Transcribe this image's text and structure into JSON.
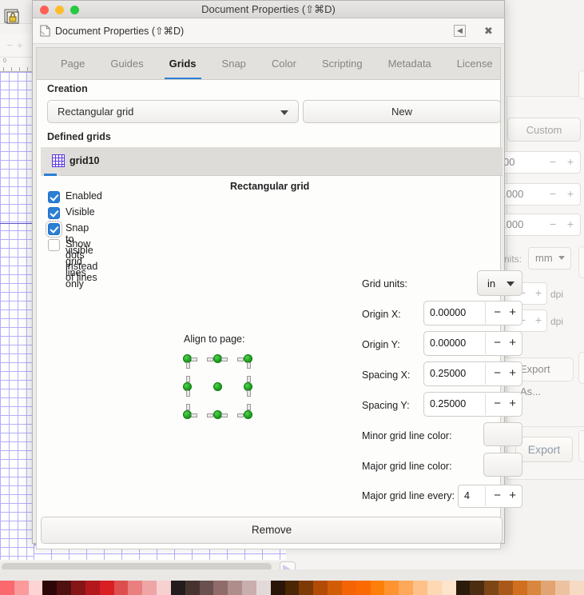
{
  "window": {
    "title": "Document Properties (⇧⌘D)",
    "subheader_title": "Document Properties (⇧⌘D)",
    "collapse_glyph": "◀",
    "close_glyph": "✖",
    "doc_icon": "document-icon"
  },
  "tabs": [
    {
      "label": "Page",
      "active": false
    },
    {
      "label": "Guides",
      "active": false
    },
    {
      "label": "Grids",
      "active": true
    },
    {
      "label": "Snap",
      "active": false
    },
    {
      "label": "Color",
      "active": false
    },
    {
      "label": "Scripting",
      "active": false
    },
    {
      "label": "Metadata",
      "active": false
    },
    {
      "label": "License",
      "active": false
    }
  ],
  "creation": {
    "section_label": "Creation",
    "grid_type": "Rectangular grid",
    "new_button": "New"
  },
  "defined_grids": {
    "section_label": "Defined grids",
    "items": [
      {
        "label": "grid10",
        "selected": true
      }
    ]
  },
  "grid_settings": {
    "title": "Rectangular grid",
    "checkboxes": [
      {
        "label": "Enabled",
        "checked": true,
        "focused": false
      },
      {
        "label": "Visible",
        "checked": true,
        "focused": false
      },
      {
        "label": "Snap to visible grid lines only",
        "checked": true,
        "focused": true
      },
      {
        "label": "Show dots instead of lines",
        "checked": false,
        "focused": false
      }
    ],
    "align_to_page_label": "Align to page:",
    "fields": [
      {
        "label": "Grid units:",
        "value": "in",
        "kind": "select"
      },
      {
        "label": "Origin X:",
        "value": "0.00000",
        "kind": "spin"
      },
      {
        "label": "Origin Y:",
        "value": "0.00000",
        "kind": "spin"
      },
      {
        "label": "Spacing X:",
        "value": "0.25000",
        "kind": "spin"
      },
      {
        "label": "Spacing Y:",
        "value": "0.25000",
        "kind": "spin"
      }
    ],
    "minor_color_label": "Minor grid line color:",
    "major_color_label": "Major grid line color:",
    "minor_color": "#5500ff",
    "major_color": "#5500ff",
    "major_every_label": "Major grid line every:",
    "major_every_value": "4",
    "minus_glyph": "−",
    "plus_glyph": "+"
  },
  "remove_button": "Remove",
  "background_panel": {
    "custom_button": "Custom",
    "collapse_glyph": "◀",
    "close_glyph": "✖",
    "fields": [
      {
        "value": "00"
      },
      {
        "value": ".000"
      },
      {
        "value": ".000"
      }
    ],
    "units_label": "nits:",
    "units_value": "mm",
    "dpi_label_1": "dpi",
    "dpi_label_2": "dpi",
    "export_as_button": "Export As...",
    "export_button": "Export",
    "minus_glyph": "−",
    "plus_glyph": "+"
  },
  "canvas": {
    "ruler_origin": "0",
    "grid_minor_color": "#b3aefb",
    "grid_major_color": "#5a54c8"
  },
  "palette": {
    "swatches": [
      "#f9696e",
      "#fb9a9a",
      "#fdd3d3",
      "#2e0608",
      "#50100f",
      "#861518",
      "#b3181d",
      "#d91f22",
      "#dd4f4f",
      "#e97f7f",
      "#eea5a6",
      "#f7d0d1",
      "#241c1c",
      "#46332f",
      "#6a504e",
      "#8f6b69",
      "#ae8d8b",
      "#c8aeac",
      "#e2dad8",
      "#2a1607",
      "#4a2605",
      "#7e3a06",
      "#b24c05",
      "#d25c06",
      "#f46304",
      "#fb6a02",
      "#fd7f0a",
      "#fe9330",
      "#fea95a",
      "#fec189",
      "#fdd8b2",
      "#fde4cd",
      "#2c1b0a",
      "#4c2d10",
      "#7c4715",
      "#a8591a",
      "#cf6f1f",
      "#d9873f",
      "#e1a472",
      "#edc2a0",
      "#f5dac4"
    ]
  }
}
